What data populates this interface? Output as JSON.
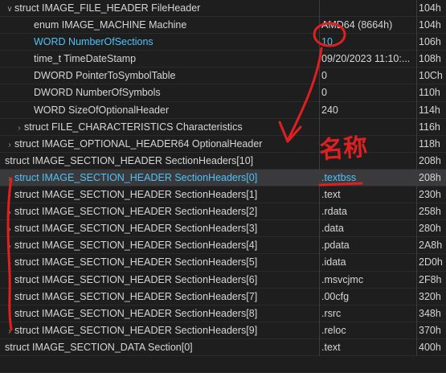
{
  "tree_rows": [
    {
      "caret": "chevron-down",
      "indent": 0,
      "name": "struct IMAGE_FILE_HEADER FileHeader",
      "value": "",
      "offset": "104h",
      "highlight": false,
      "selected": false
    },
    {
      "caret": "",
      "indent": 2,
      "name": "enum IMAGE_MACHINE Machine",
      "value": "AMD64 (8664h)",
      "offset": "104h",
      "highlight": false,
      "selected": false
    },
    {
      "caret": "",
      "indent": 2,
      "name": "WORD NumberOfSections",
      "value": "10",
      "offset": "106h",
      "highlight": true,
      "selected": false
    },
    {
      "caret": "",
      "indent": 2,
      "name": "time_t TimeDateStamp",
      "value": "09/20/2023 11:10:...",
      "offset": "108h",
      "highlight": false,
      "selected": false
    },
    {
      "caret": "",
      "indent": 2,
      "name": "DWORD PointerToSymbolTable",
      "value": "0",
      "offset": "10Ch",
      "highlight": false,
      "selected": false
    },
    {
      "caret": "",
      "indent": 2,
      "name": "DWORD NumberOfSymbols",
      "value": "0",
      "offset": "110h",
      "highlight": false,
      "selected": false
    },
    {
      "caret": "",
      "indent": 2,
      "name": "WORD SizeOfOptionalHeader",
      "value": "240",
      "offset": "114h",
      "highlight": false,
      "selected": false
    },
    {
      "caret": "chevron-right",
      "indent": 1,
      "name": "struct FILE_CHARACTERISTICS Characteristics",
      "value": "",
      "offset": "116h",
      "highlight": false,
      "selected": false
    },
    {
      "caret": "chevron-right",
      "indent": 0,
      "name": "struct IMAGE_OPTIONAL_HEADER64 OptionalHeader",
      "value": "",
      "offset": "118h",
      "highlight": false,
      "selected": false
    },
    {
      "caret": "",
      "indent": 0,
      "name": "struct IMAGE_SECTION_HEADER SectionHeaders[10]",
      "value": "",
      "offset": "208h",
      "highlight": false,
      "selected": false
    },
    {
      "caret": "chevron-right",
      "indent": 0,
      "name": "struct IMAGE_SECTION_HEADER SectionHeaders[0]",
      "value": ".textbss",
      "offset": "208h",
      "highlight": true,
      "selected": true
    },
    {
      "caret": "chevron-right",
      "indent": 0,
      "name": "struct IMAGE_SECTION_HEADER SectionHeaders[1]",
      "value": ".text",
      "offset": "230h",
      "highlight": false,
      "selected": false
    },
    {
      "caret": "chevron-right",
      "indent": 0,
      "name": "struct IMAGE_SECTION_HEADER SectionHeaders[2]",
      "value": ".rdata",
      "offset": "258h",
      "highlight": false,
      "selected": false
    },
    {
      "caret": "chevron-right",
      "indent": 0,
      "name": "struct IMAGE_SECTION_HEADER SectionHeaders[3]",
      "value": ".data",
      "offset": "280h",
      "highlight": false,
      "selected": false
    },
    {
      "caret": "chevron-right",
      "indent": 0,
      "name": "struct IMAGE_SECTION_HEADER SectionHeaders[4]",
      "value": ".pdata",
      "offset": "2A8h",
      "highlight": false,
      "selected": false
    },
    {
      "caret": "chevron-right",
      "indent": 0,
      "name": "struct IMAGE_SECTION_HEADER SectionHeaders[5]",
      "value": ".idata",
      "offset": "2D0h",
      "highlight": false,
      "selected": false
    },
    {
      "caret": "chevron-right",
      "indent": 0,
      "name": "struct IMAGE_SECTION_HEADER SectionHeaders[6]",
      "value": ".msvcjmc",
      "offset": "2F8h",
      "highlight": false,
      "selected": false
    },
    {
      "caret": "chevron-right",
      "indent": 0,
      "name": "struct IMAGE_SECTION_HEADER SectionHeaders[7]",
      "value": ".00cfg",
      "offset": "320h",
      "highlight": false,
      "selected": false
    },
    {
      "caret": "chevron-right",
      "indent": 0,
      "name": "struct IMAGE_SECTION_HEADER SectionHeaders[8]",
      "value": ".rsrc",
      "offset": "348h",
      "highlight": false,
      "selected": false
    },
    {
      "caret": "chevron-right",
      "indent": 0,
      "name": "struct IMAGE_SECTION_HEADER SectionHeaders[9]",
      "value": ".reloc",
      "offset": "370h",
      "highlight": false,
      "selected": false
    },
    {
      "caret": "",
      "indent": 0,
      "name": "struct IMAGE_SECTION_DATA Section[0]",
      "value": ".text",
      "offset": "400h",
      "highlight": false,
      "selected": false
    },
    {
      "caret": "",
      "indent": 0,
      "name": "",
      "value": "",
      "offset": "",
      "highlight": false,
      "selected": false
    }
  ],
  "annotation": {
    "handwritten_text": "名称",
    "color": "#e02020"
  },
  "colors": {
    "background": "#1e1e1e",
    "text": "#d6d6d6",
    "highlight_text": "#4fc3f7",
    "selected_row": "#3a3a3d"
  }
}
